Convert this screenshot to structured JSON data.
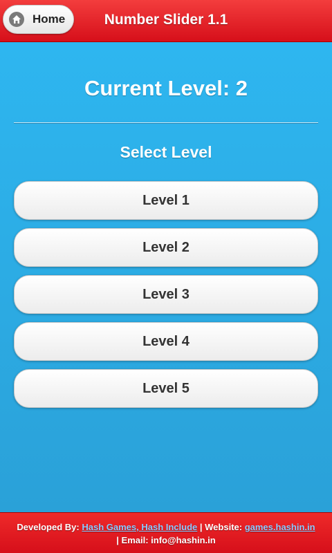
{
  "header": {
    "home_label": "Home",
    "home_icon": "home-icon",
    "title": "Number Slider 1.1"
  },
  "main": {
    "current_level_text": "Current Level: 2",
    "select_heading": "Select Level",
    "levels": [
      {
        "label": "Level 1"
      },
      {
        "label": "Level 2"
      },
      {
        "label": "Level 3"
      },
      {
        "label": "Level 4"
      },
      {
        "label": "Level 5"
      }
    ]
  },
  "footer": {
    "developed_label": "Developed By:",
    "developer_link": "Hash Games, Hash Include",
    "website_label": "| Website:",
    "website_link": "games.hashin.in",
    "email_text": "| Email: info@hashin.in"
  },
  "colors": {
    "header_bg": "#e2141f",
    "content_bg": "#2aaeea",
    "link": "#8ec9ff"
  }
}
